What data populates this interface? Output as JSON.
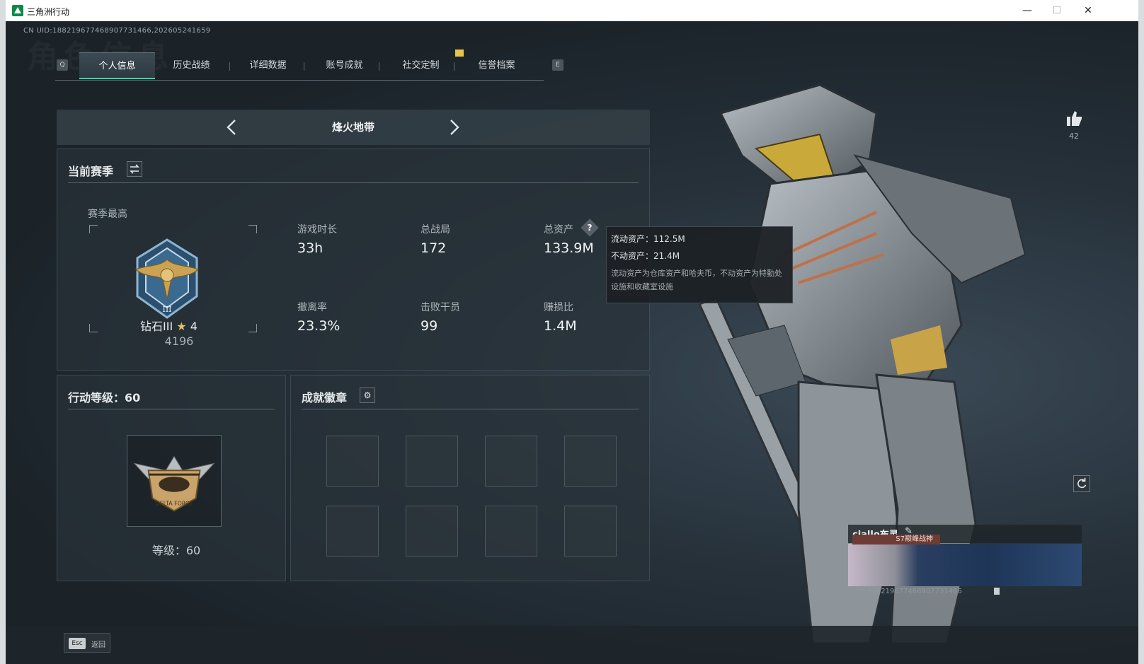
{
  "window": {
    "title": "三角洲行动",
    "controls": [
      "—",
      "☐",
      "✕"
    ]
  },
  "uid_line": "CN UID:1882196774689077314​66,202605241659",
  "bg_word": "角色信息",
  "tab_keys": {
    "left": "Q",
    "right": "E"
  },
  "tabs": [
    "个人信息",
    "历史战绩",
    "详细数据",
    "账号成就",
    "社交定制",
    "信誉档案"
  ],
  "mode": {
    "name": "烽火地带"
  },
  "season": {
    "title": "当前赛季",
    "best_label": "赛季最高",
    "rank_name": "钻石III",
    "rank_stars": "4",
    "rank_score": "4196",
    "stats": [
      {
        "label": "游戏时长",
        "value": "33h"
      },
      {
        "label": "总战局",
        "value": "172"
      },
      {
        "label": "总资产",
        "value": "133.9M"
      },
      {
        "label": "撤离率",
        "value": "23.3%"
      },
      {
        "label": "击败干员",
        "value": "99"
      },
      {
        "label": "赚损比",
        "value": "1.4M"
      }
    ]
  },
  "tooltip": {
    "liquid": "流动资产：112.5M",
    "fixed": "不动资产：21.4M",
    "desc": "流动资产为仓库资产和哈夫币，不动资产为特勤处设施和收藏室设施"
  },
  "action_level": {
    "title": "行动等级：60",
    "level_text": "等级：60"
  },
  "badges": {
    "title": "成就徽章"
  },
  "likes": {
    "count": "42"
  },
  "player": {
    "name": "ciallo布灵",
    "title_tag": "S7巅峰战神",
    "uid": "UID 1882196774689077314​66"
  },
  "footer": {
    "esc_key": "Esc",
    "esc_label": "返回"
  },
  "colors": {
    "accent": "#30d9a4",
    "notice": "#e7c34a"
  }
}
